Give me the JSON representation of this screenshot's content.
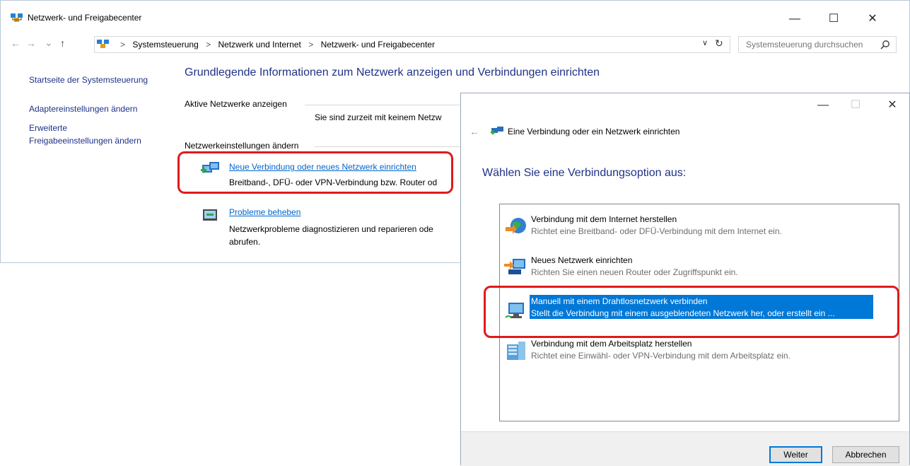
{
  "window": {
    "title": "Netzwerk- und Freigabecenter",
    "controls": {
      "minimize": "—",
      "maximize": "☐",
      "close": "✕"
    }
  },
  "address": {
    "nav": {
      "back": "←",
      "forward": "→",
      "recent": "⌄",
      "up": "↑"
    },
    "breadcrumb": [
      "Systemsteuerung",
      "Netzwerk und Internet",
      "Netzwerk- und Freigabecenter"
    ],
    "separator": ">",
    "dropdown": "∨",
    "refresh": "↻",
    "search_placeholder": "Systemsteuerung durchsuchen"
  },
  "sidebar": {
    "items": [
      {
        "label": "Startseite der Systemsteuerung"
      },
      {
        "label": "Adaptereinstellungen ändern"
      },
      {
        "label": "Erweiterte"
      },
      {
        "label": "Freigabeeinstellungen ändern"
      }
    ]
  },
  "main": {
    "title": "Grundlegende Informationen zum Netzwerk anzeigen und Verbindungen einrichten",
    "active_networks_label": "Aktive Netzwerke anzeigen",
    "no_network_msg": "Sie sind zurzeit mit keinem Netzw",
    "settings_label": "Netzwerkeinstellungen ändern",
    "tasks": [
      {
        "link": "Neue Verbindung oder neues Netzwerk einrichten",
        "desc": "Breitband-, DFÜ- oder VPN-Verbindung bzw. Router od"
      },
      {
        "link": "Probleme beheben",
        "desc": "Netzwerkprobleme diagnostizieren und reparieren ode",
        "desc2": "abrufen."
      }
    ]
  },
  "dialog": {
    "controls": {
      "minimize": "—",
      "maximize": "☐",
      "close": "✕"
    },
    "back": "←",
    "title": "Eine Verbindung oder ein Netzwerk einrichten",
    "heading": "Wählen Sie eine Verbindungsoption aus:",
    "options": [
      {
        "title": "Verbindung mit dem Internet herstellen",
        "desc": "Richtet eine Breitband- oder DFÜ-Verbindung mit dem Internet ein.",
        "icon": "internet-globe-icon"
      },
      {
        "title": "Neues Netzwerk einrichten",
        "desc": "Richten Sie einen neuen Router oder Zugriffspunkt ein.",
        "icon": "new-network-icon"
      },
      {
        "title": "Manuell mit einem Drahtlosnetzwerk verbinden",
        "desc": "Stellt die Verbindung mit einem ausgeblendeten Netzwerk her, oder erstellt ein ...",
        "icon": "wireless-network-icon",
        "selected": true
      },
      {
        "title": "Verbindung mit dem Arbeitsplatz herstellen",
        "desc": "Richtet eine Einwähl- oder VPN-Verbindung mit dem Arbeitsplatz ein.",
        "icon": "workplace-icon"
      }
    ],
    "buttons": {
      "next": "Weiter",
      "cancel": "Abbrechen"
    }
  },
  "colors": {
    "accent_blue": "#1e3287",
    "link": "#0066cc",
    "selection": "#0078d7",
    "highlight_box": "#e01a1a"
  }
}
